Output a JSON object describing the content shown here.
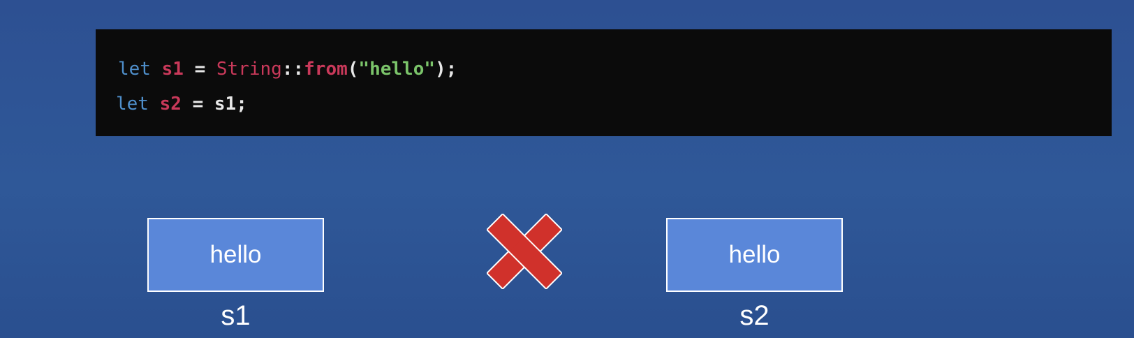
{
  "code": {
    "line1": {
      "kw": "let",
      "var": "s1",
      "eq": "=",
      "type": "String",
      "sep": "::",
      "fn": "from",
      "open": "(",
      "str": "\"hello\"",
      "close": ");"
    },
    "line2": {
      "kw": "let",
      "var": "s2",
      "eq": "=",
      "value": "s1",
      "end": ";"
    }
  },
  "diagram": {
    "box1": {
      "value": "hello",
      "label": "s1"
    },
    "box2": {
      "value": "hello",
      "label": "s2"
    },
    "cross_icon": "red-x-icon"
  },
  "colors": {
    "background": "#2d5092",
    "code_background": "#0b0b0b",
    "box_fill": "#5a87d9",
    "cross": "#d0312b",
    "keyword": "#4f8fcb",
    "identifier": "#c9395a",
    "string": "#7bc46a"
  }
}
